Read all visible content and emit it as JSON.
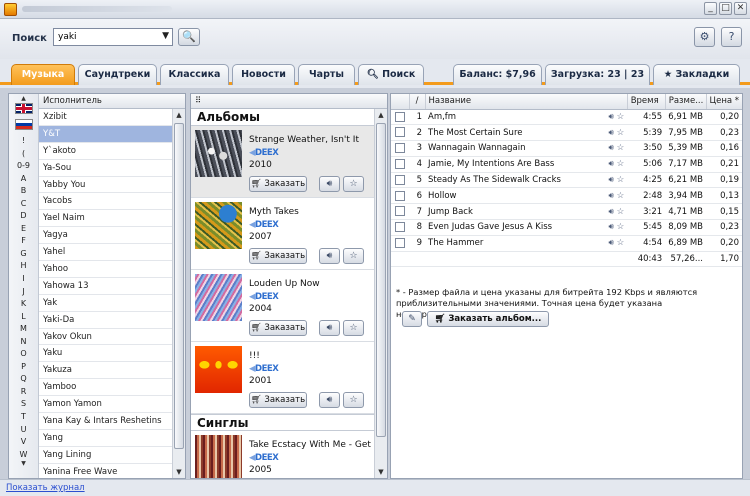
{
  "window": {
    "minimize": "_",
    "maximize": "□",
    "close": "✕"
  },
  "search": {
    "label": "Поиск",
    "value": "yaki",
    "dropdown_glyph": "▼",
    "button_glyph": "🔍"
  },
  "toolbar": {
    "settings_glyph": "⚙",
    "help_glyph": "?"
  },
  "tabs": [
    {
      "label": "Музыка",
      "active": true
    },
    {
      "label": "Саундтреки"
    },
    {
      "label": "Классика"
    },
    {
      "label": "Новости"
    },
    {
      "label": "Чарты"
    },
    {
      "label": "Поиск",
      "icon": "search-icon"
    }
  ],
  "status": {
    "balance": "Баланс: $7,96",
    "downloads": "Загрузка: 23 | 23",
    "bookmarks": "Закладки"
  },
  "alphabet": [
    "!",
    "(",
    "0-9",
    "A",
    "B",
    "C",
    "D",
    "E",
    "F",
    "G",
    "H",
    "I",
    "J",
    "K",
    "L",
    "M",
    "N",
    "O",
    "P",
    "Q",
    "R",
    "S",
    "T",
    "U",
    "V",
    "W"
  ],
  "artists": {
    "header": "Исполнитель",
    "selected_index": 1,
    "items": [
      "Xzibit",
      "Y&T",
      "Y`akoto",
      "Ya-Sou",
      "Yabby You",
      "Yacobs",
      "Yael Naim",
      "Yagya",
      "Yahel",
      "Yahoo",
      "Yahowa 13",
      "Yak",
      "Yaki-Da",
      "Yakov Okun",
      "Yaku",
      "Yakuza",
      "Yamboo",
      "Yamon Yamon",
      "Yana Kay & Intars Reshetins",
      "Yang",
      "Yang Lining",
      "Yanina Free Wave"
    ]
  },
  "albums": {
    "section_title": "Альбомы",
    "order_label": "Заказать",
    "items": [
      {
        "title": "Strange Weather, Isn't It",
        "label": "DEEX",
        "year": "2010",
        "highlighted": true
      },
      {
        "title": "Myth Takes",
        "label": "DEEX",
        "year": "2007"
      },
      {
        "title": "Louden Up Now",
        "label": "DEEX",
        "year": "2004"
      },
      {
        "title": "!!!",
        "label": "DEEX",
        "year": "2001"
      }
    ]
  },
  "singles": {
    "section_title": "Синглы",
    "items": [
      {
        "title": "Take Ecstacy With Me - Get Up",
        "label": "DEEX",
        "year": "2005"
      }
    ]
  },
  "tracks": {
    "headers": {
      "chk": "",
      "num": "/",
      "title": "Название",
      "time": "Время",
      "size": "Разме...",
      "price": "Цена *"
    },
    "rows": [
      {
        "n": "1",
        "title": "Am,fm",
        "time": "4:55",
        "size": "6,91 MB",
        "price": "0,20"
      },
      {
        "n": "2",
        "title": "The Most Certain Sure",
        "time": "5:39",
        "size": "7,95 MB",
        "price": "0,23"
      },
      {
        "n": "3",
        "title": "Wannagain Wannagain",
        "time": "3:50",
        "size": "5,39 MB",
        "price": "0,16"
      },
      {
        "n": "4",
        "title": "Jamie, My Intentions Are Bass",
        "time": "5:06",
        "size": "7,17 MB",
        "price": "0,21"
      },
      {
        "n": "5",
        "title": "Steady As The Sidewalk Cracks",
        "time": "4:25",
        "size": "6,21 MB",
        "price": "0,19"
      },
      {
        "n": "6",
        "title": "Hollow",
        "time": "2:48",
        "size": "3,94 MB",
        "price": "0,13"
      },
      {
        "n": "7",
        "title": "Jump Back",
        "time": "3:21",
        "size": "4,71 MB",
        "price": "0,15"
      },
      {
        "n": "8",
        "title": "Even Judas Gave Jesus A Kiss",
        "time": "5:45",
        "size": "8,09 MB",
        "price": "0,23"
      },
      {
        "n": "9",
        "title": "The Hammer",
        "time": "4:54",
        "size": "6,89 MB",
        "price": "0,20"
      }
    ],
    "totals": {
      "time": "40:43",
      "size": "57,26...",
      "price": "1,70"
    },
    "note": "* - Размер файла и цена указаны для битрейта 192 Kbps и являются приблизительными значениями. Точная цена будет указана  непосредственно в",
    "order_album_label": "Заказать альбом..."
  },
  "footer": {
    "journal_link": "Показать журнал"
  }
}
